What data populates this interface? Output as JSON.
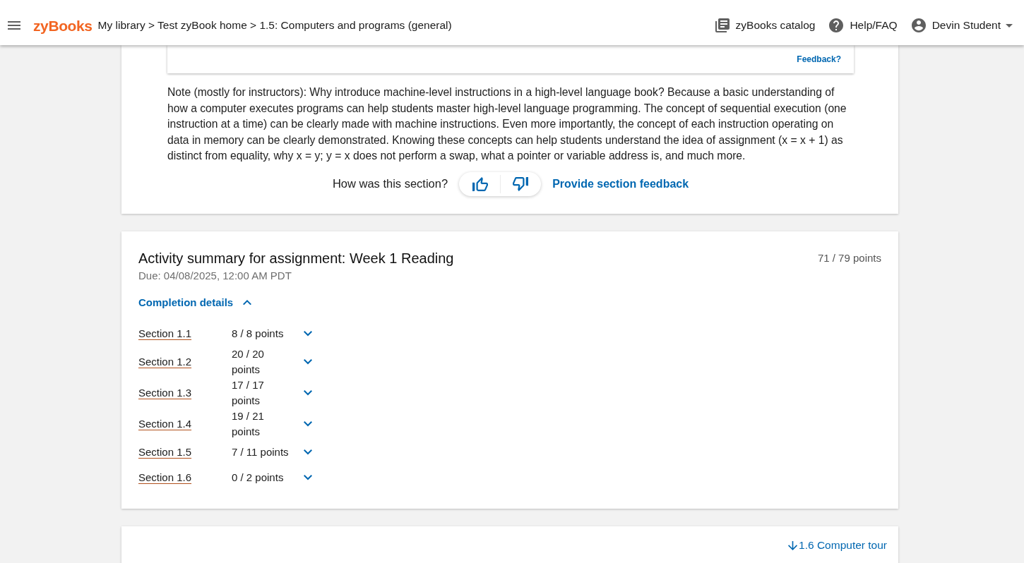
{
  "navbar": {
    "logo": "zyBooks",
    "breadcrumb": "My library > Test zyBook home > 1.5: Computers and programs (general)",
    "links": [
      {
        "kind": "catalog",
        "label": "zyBooks catalog"
      },
      {
        "kind": "help",
        "label": "Help/FAQ"
      }
    ],
    "user": {
      "name": "Devin Student"
    }
  },
  "section_card": {
    "feedback_link": "Feedback?",
    "note": "Note (mostly for instructors): Why introduce machine-level instructions in a high-level language book? Because a basic understanding of how a computer executes programs can help students master high-level language programming. The concept of sequential execution (one instruction at a time) can be clearly made with machine instructions. Even more importantly, the concept of each instruction operating on data in memory can be clearly demonstrated. Knowing these concepts can help students understand the idea of assignment (x = x + 1) as distinct from equality, why x = y; y = x does not perform a swap, what a pointer or variable address is, and much more.",
    "rating_prompt": "How was this section?",
    "section_feedback_link": "Provide section feedback"
  },
  "activity_summary": {
    "title": "Activity summary for assignment: Week 1 Reading",
    "total_points": "71 / 79 points",
    "due": "Due: 04/08/2025, 12:00 AM PDT",
    "completion_details": {
      "label": "Completion details",
      "expanded": true
    },
    "sections": [
      {
        "label": "Section 1.1",
        "points": "8 / 8 points",
        "expanded": false
      },
      {
        "label": "Section 1.2",
        "points": "20 / 20 points",
        "expanded": false
      },
      {
        "label": "Section 1.3",
        "points": "17 / 17 points",
        "expanded": false
      },
      {
        "label": "Section 1.4",
        "points": "19 / 21 points",
        "expanded": false
      },
      {
        "label": "Section 1.5",
        "points": "7 / 11 points",
        "expanded": false
      },
      {
        "label": "Section 1.6",
        "points": "0 / 2 points",
        "expanded": false
      }
    ]
  },
  "next_section": {
    "label": "1.6 Computer tour"
  }
}
